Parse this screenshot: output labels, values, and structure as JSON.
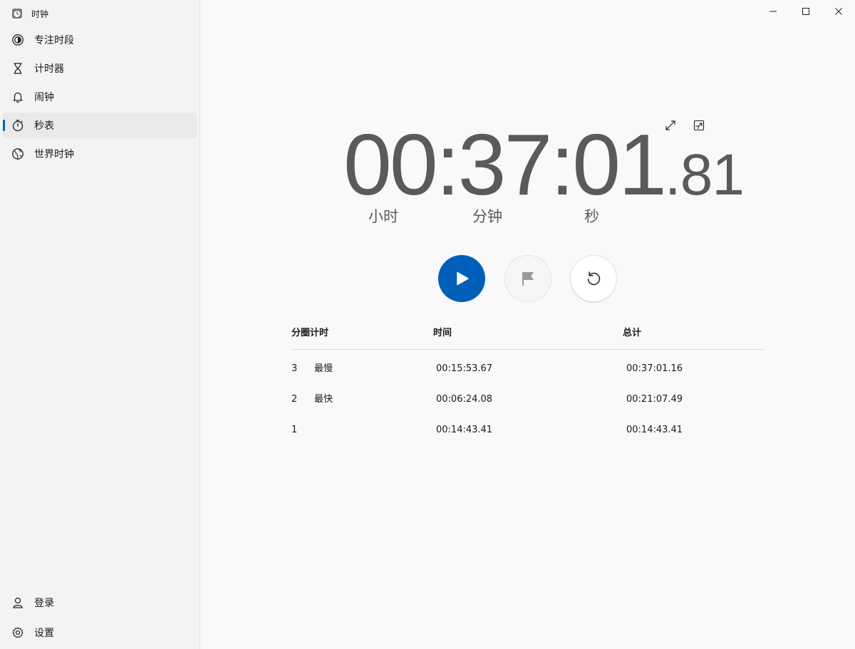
{
  "app": {
    "title": "时钟"
  },
  "sidebar": {
    "items": [
      {
        "label": "专注时段",
        "icon": "focus-icon"
      },
      {
        "label": "计时器",
        "icon": "hourglass-icon"
      },
      {
        "label": "闹钟",
        "icon": "bell-icon"
      },
      {
        "label": "秒表",
        "icon": "stopwatch-icon",
        "active": true
      },
      {
        "label": "世界时钟",
        "icon": "globe-icon"
      }
    ],
    "bottom": [
      {
        "label": "登录",
        "icon": "person-icon"
      },
      {
        "label": "设置",
        "icon": "gear-icon"
      }
    ]
  },
  "stopwatch": {
    "hours": "00",
    "sep1": ":",
    "minutes": "37",
    "sep2": ":",
    "seconds": "01",
    "dot": ".",
    "hundredths": "81",
    "unit_hours": "小时",
    "unit_minutes": "分钟",
    "unit_seconds": "秒"
  },
  "laps": {
    "headers": {
      "lap": "分圈计时",
      "time": "时间",
      "total": "总计"
    },
    "rows": [
      {
        "num": "3",
        "tag": "最慢",
        "time": "00:15:53.67",
        "total": "00:37:01.16"
      },
      {
        "num": "2",
        "tag": "最快",
        "time": "00:06:24.08",
        "total": "00:21:07.49"
      },
      {
        "num": "1",
        "tag": "",
        "time": "00:14:43.41",
        "total": "00:14:43.41"
      }
    ]
  },
  "colors": {
    "accent": "#005fb8",
    "timer_text": "#5a5a5a",
    "sidebar_bg": "#f3f3f3"
  }
}
